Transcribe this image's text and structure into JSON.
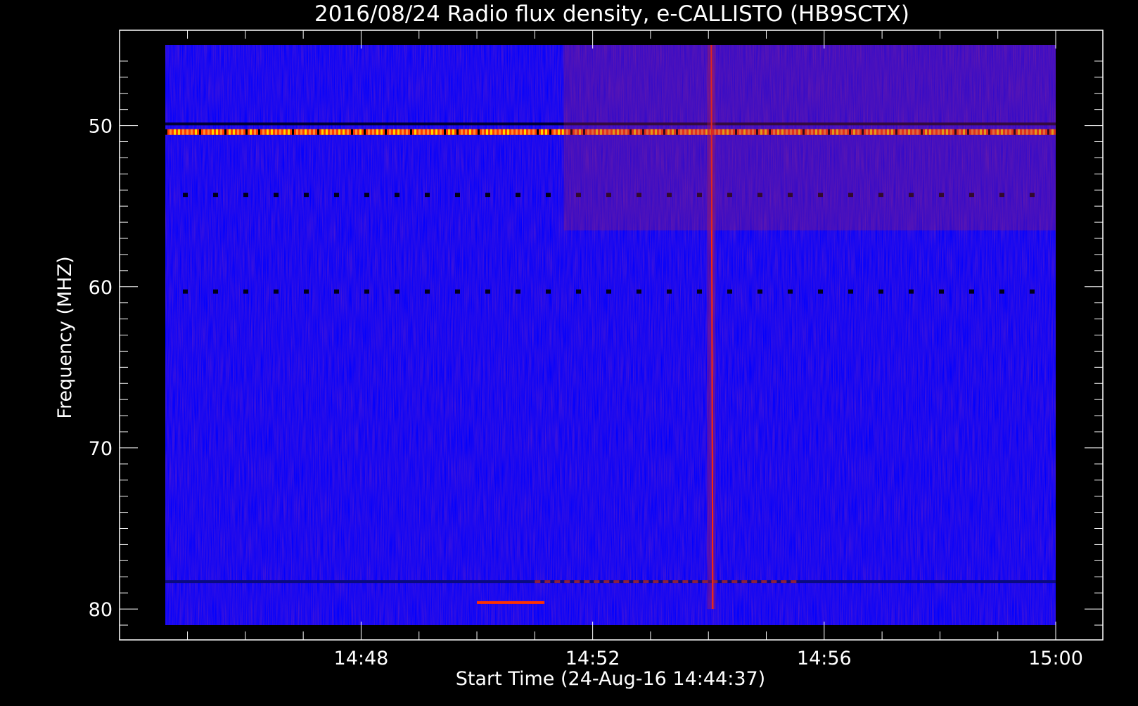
{
  "chart_data": {
    "type": "heatmap",
    "title": "2016/08/24  Radio flux density, e-CALLISTO (HB9SCTX)",
    "xlabel": "Start Time (24-Aug-16 14:44:37)",
    "ylabel": "Frequency (MHZ)",
    "x_ticks": [
      "14:48",
      "14:52",
      "14:56",
      "15:00"
    ],
    "x_tick_minutes": [
      888,
      892,
      896,
      900
    ],
    "y_ticks": [
      50,
      60,
      70,
      80
    ],
    "xlim": [
      "14:44:37",
      "15:00:00"
    ],
    "ylim": [
      81,
      45
    ],
    "y_axis_inverted": true,
    "grid": false,
    "colorscale": [
      "#0000ff",
      "#8a2040",
      "#ff2000",
      "#ffd800",
      "#ffffff"
    ],
    "features": [
      {
        "kind": "horizontal_band",
        "freq_mhz": 50.4,
        "t_start": "14:44:37",
        "t_end": "15:00:00",
        "intensity": "high"
      },
      {
        "kind": "dark_row",
        "freq_mhz": 49.9,
        "t_start": "14:44:37",
        "t_end": "15:00:00"
      },
      {
        "kind": "dotted_row",
        "freq_mhz": 54.3,
        "t_start": "14:44:37",
        "t_end": "15:00:00"
      },
      {
        "kind": "dotted_row",
        "freq_mhz": 60.3,
        "t_start": "14:44:37",
        "t_end": "15:00:00"
      },
      {
        "kind": "horizontal_band",
        "freq_mhz": 78.3,
        "t_start": "14:44:37",
        "t_end": "15:00:00",
        "intensity": "low"
      },
      {
        "kind": "vertical_burst",
        "time": "14:54:03",
        "freq_from_mhz": 45,
        "freq_to_mhz": 80,
        "intensity": "medium"
      },
      {
        "kind": "short_segment",
        "freq_mhz": 79.6,
        "t_start": "14:50:00",
        "t_end": "14:51:10",
        "intensity": "high"
      },
      {
        "kind": "background_shift",
        "t_start": "14:51:30",
        "t_end": "15:00:00",
        "note": "warmer purple background"
      }
    ]
  }
}
